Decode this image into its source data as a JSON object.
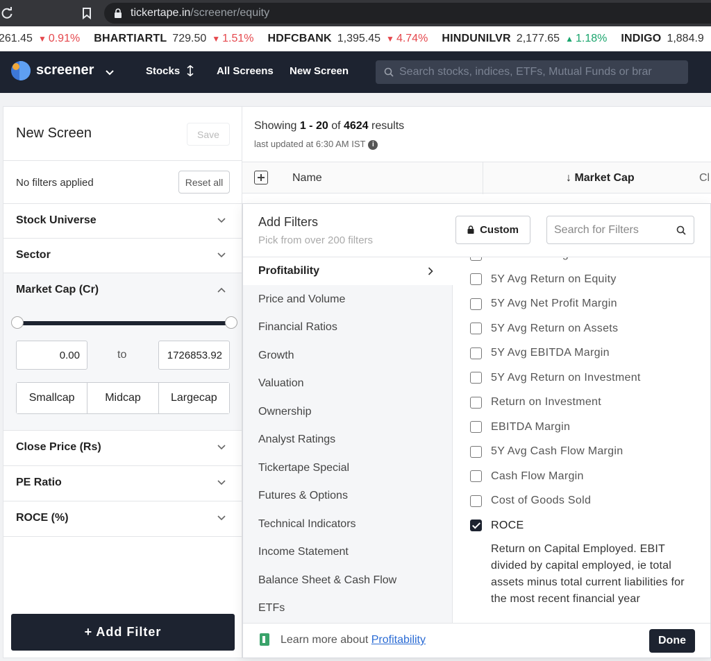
{
  "browser": {
    "url_host": "tickertape.in",
    "url_path": "/screener/equity"
  },
  "ticker": [
    {
      "symbol": "",
      "price": "261.45",
      "change": "0.91%",
      "direction": "down"
    },
    {
      "symbol": "BHARTIARTL",
      "price": "729.50",
      "change": "1.51%",
      "direction": "down"
    },
    {
      "symbol": "HDFCBANK",
      "price": "1,395.45",
      "change": "4.74%",
      "direction": "down"
    },
    {
      "symbol": "HINDUNILVR",
      "price": "2,177.65",
      "change": "1.18%",
      "direction": "up"
    },
    {
      "symbol": "INDIGO",
      "price": "1,884.9",
      "change": "",
      "direction": ""
    }
  ],
  "header": {
    "logo": "screener",
    "nav": [
      "Stocks",
      "All Screens",
      "New Screen"
    ],
    "search_placeholder": "Search stocks, indices, ETFs, Mutual Funds or brar"
  },
  "left_panel": {
    "title": "New Screen",
    "save_label": "Save",
    "no_filters": "No filters applied",
    "reset_label": "Reset all",
    "sections": [
      "Stock Universe",
      "Sector",
      "Market Cap (Cr)",
      "Close Price (Rs)",
      "PE Ratio",
      "ROCE (%)"
    ],
    "market_cap": {
      "min": "0.00",
      "to_label": "to",
      "max": "1726853.92",
      "caps": [
        "Smallcap",
        "Midcap",
        "Largecap"
      ]
    },
    "add_filter_label": "+  Add Filter"
  },
  "results": {
    "showing_prefix": "Showing ",
    "range": "1 - 20",
    "of": " of ",
    "total": "4624",
    "suffix": " results",
    "last_updated": "last updated at 6:30 AM IST",
    "columns": {
      "name": "Name",
      "market_cap": "↓ Market Cap",
      "next": "Cl"
    }
  },
  "add_filters": {
    "title": "Add Filters",
    "subtitle": "Pick from over 200 filters",
    "custom_label": "Custom",
    "search_placeholder": "Search for Filters",
    "categories": [
      "Profitability",
      "Price and Volume",
      "Financial Ratios",
      "Growth",
      "Valuation",
      "Ownership",
      "Analyst Ratings",
      "Tickertape Special",
      "Futures & Options",
      "Technical Indicators",
      "Income Statement",
      "Balance Sheet & Cash Flow",
      "ETFs"
    ],
    "active_category": "Profitability",
    "options": [
      {
        "label": "Net Profit Margin",
        "checked": false
      },
      {
        "label": "5Y Avg Return on Equity",
        "checked": false
      },
      {
        "label": "5Y Avg Net Profit Margin",
        "checked": false
      },
      {
        "label": "5Y Avg Return on Assets",
        "checked": false
      },
      {
        "label": "5Y Avg EBITDA Margin",
        "checked": false
      },
      {
        "label": "5Y Avg Return on Investment",
        "checked": false
      },
      {
        "label": "Return on Investment",
        "checked": false
      },
      {
        "label": "EBITDA Margin",
        "checked": false
      },
      {
        "label": "5Y Avg Cash Flow Margin",
        "checked": false
      },
      {
        "label": "Cash Flow Margin",
        "checked": false
      },
      {
        "label": "Cost of Goods Sold",
        "checked": false
      },
      {
        "label": "ROCE",
        "checked": true
      }
    ],
    "roce_description": "Return on Capital Employed. EBIT divided by capital employed, ie total assets minus total current liabilities for the most recent financial year",
    "learn_prefix": "Learn more about ",
    "learn_link": "Profitability",
    "done_label": "Done"
  }
}
